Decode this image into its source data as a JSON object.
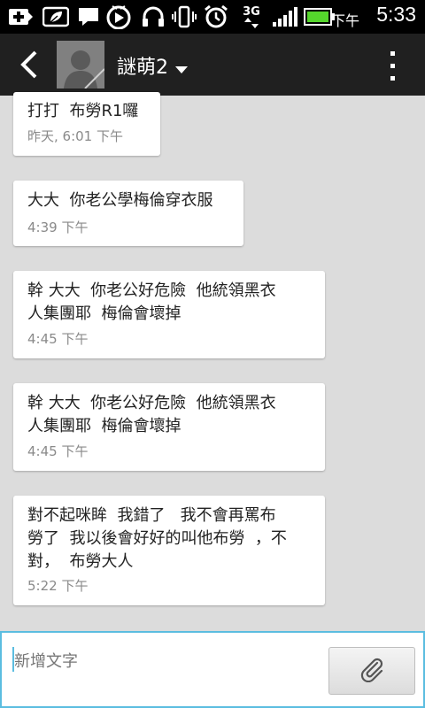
{
  "status_bar": {
    "ampm": "下午",
    "time": "5:33",
    "network": "3G",
    "icons": [
      "add-icon",
      "leaf-icon",
      "chat-icon",
      "media-icon",
      "headphones-icon",
      "vibrate-icon",
      "alarm-icon",
      "network-3g-icon",
      "signal-icon",
      "battery-icon"
    ]
  },
  "header": {
    "back_icon": "back-chevron-icon",
    "contact_name": "謎萌2",
    "dropdown_icon": "caret-down-icon",
    "menu_icon": "overflow-menu-icon"
  },
  "messages": [
    {
      "text": "打打  布勞R1囉",
      "time": "昨天, 6:01 下午"
    },
    {
      "text": "大大  你老公學梅倫穿衣服",
      "time": "4:39 下午"
    },
    {
      "text": "幹 大大  你老公好危險  他統領黑衣\n人集團耶  梅倫會壞掉",
      "time": "4:45 下午"
    },
    {
      "text": "幹 大大  你老公好危險  他統領黑衣\n人集團耶  梅倫會壞掉",
      "time": "4:45 下午"
    },
    {
      "text": "對不起咪眸  我錯了   我不會再罵布\n勞了  我以後會好好的叫他布勞  ，不\n對，  布勞大人",
      "time": "5:22 下午"
    }
  ],
  "compose": {
    "placeholder": "新增文字",
    "attach_icon": "paperclip-icon"
  },
  "colors": {
    "accent": "#5bbde0",
    "header_bg": "#202020",
    "list_bg": "#dcdcdc",
    "battery": "#55d62c"
  }
}
